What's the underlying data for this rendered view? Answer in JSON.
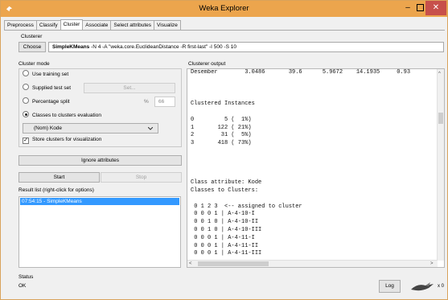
{
  "window": {
    "title": "Weka Explorer",
    "accent": "#eca54d",
    "close_color": "#c7504b",
    "selection_color": "#3399ff"
  },
  "tabs": [
    {
      "label": "Preprocess"
    },
    {
      "label": "Classify"
    },
    {
      "label": "Cluster"
    },
    {
      "label": "Associate"
    },
    {
      "label": "Select attributes"
    },
    {
      "label": "Visualize"
    }
  ],
  "clusterer": {
    "group_label": "Clusterer",
    "choose_label": "Choose",
    "algorithm": "SimpleKMeans",
    "options": " -N 4 -A \"weka.core.EuclideanDistance -R first-last\" -I 500 -S 10"
  },
  "cluster_mode": {
    "group_label": "Cluster mode",
    "use_training_set": "Use training set",
    "supplied_test_set": "Supplied test set",
    "set_label": "Set...",
    "percentage_split": "Percentage split",
    "percent_symbol": "%",
    "percentage_value": "66",
    "classes_to_clusters": "Classes to clusters evaluation",
    "class_attribute_select": "(Nom) Kode",
    "store_clusters": "Store clusters for visualization",
    "selected_mode": "classes_to_clusters",
    "store_checked": true
  },
  "ignore_attributes_label": "Ignore attributes",
  "start_label": "Start",
  "stop_label": "Stop",
  "result_list": {
    "group_label": "Result list (right-click for options)",
    "items": [
      "07:54:15 - SimpleKMeans"
    ]
  },
  "output": {
    "group_label": "Clusterer output",
    "lines": [
      "Desember        3.0486       39.6      5.9672    14.1935     0.93",
      "",
      "",
      "",
      "Clustered Instances",
      "",
      "0         5 (  1%)",
      "1       122 ( 21%)",
      "2        31 (  5%)",
      "3       418 ( 73%)",
      "",
      "",
      "",
      "",
      "Class attribute: Kode",
      "Classes to Clusters:",
      "",
      " 0 1 2 3  <-- assigned to cluster",
      " 0 0 0 1 | A-4-10-I",
      " 0 0 1 0 | A-4-10-II",
      " 0 0 1 0 | A-4-10-III",
      " 0 0 0 1 | A-4-11-I",
      " 0 0 0 1 | A-4-11-II",
      " 0 0 0 1 | A-4-11-III"
    ]
  },
  "status": {
    "group_label": "Status",
    "text": "OK",
    "log_label": "Log",
    "task_count": "x 0"
  }
}
